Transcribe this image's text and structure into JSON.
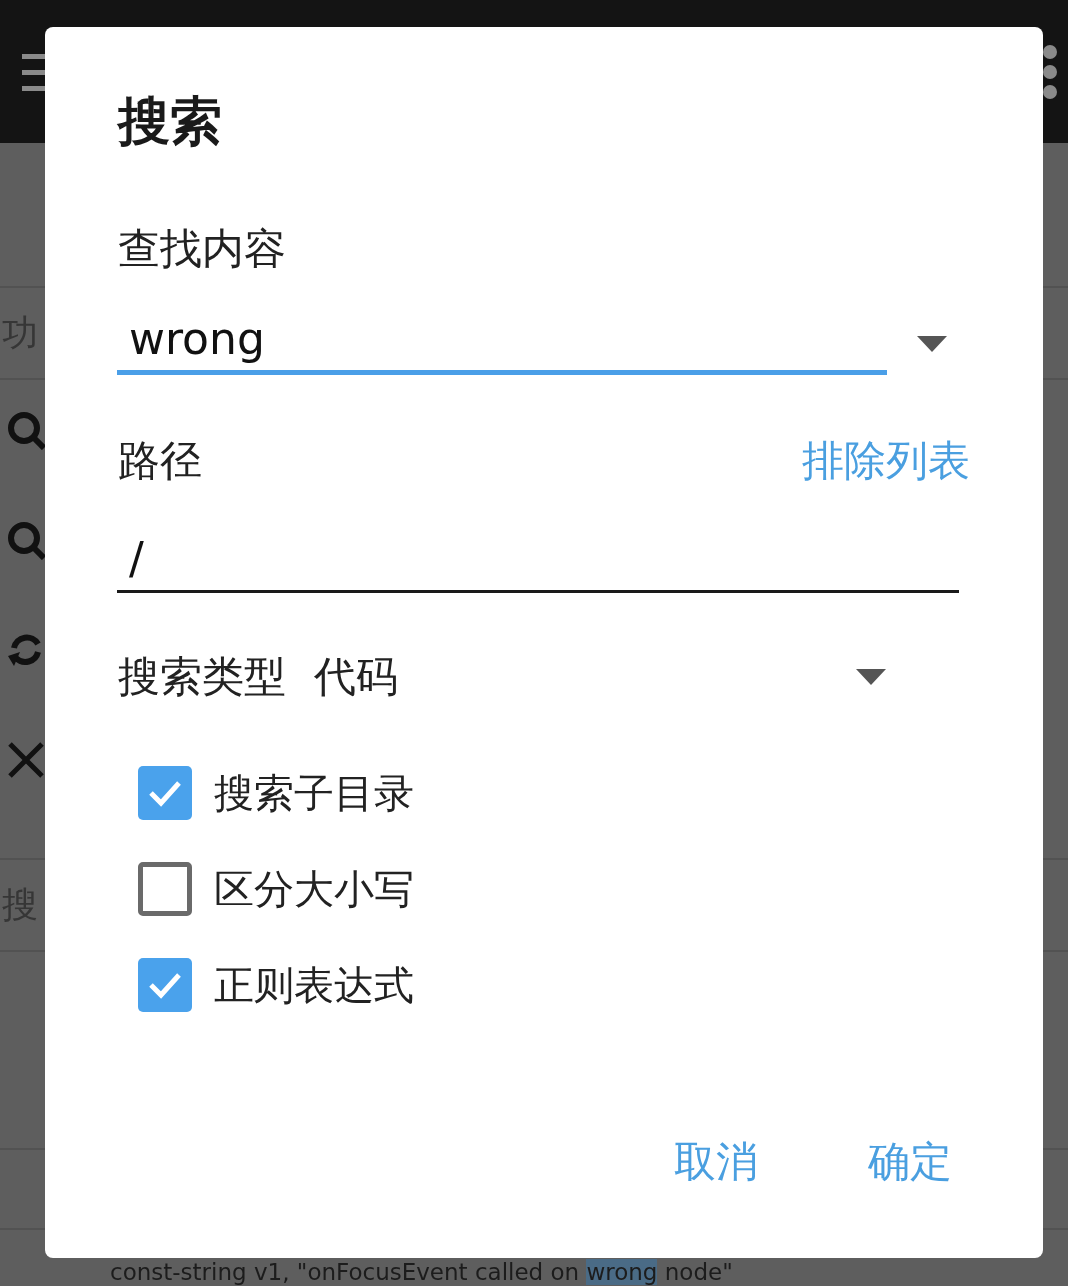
{
  "background": {
    "side_labels": [
      "功",
      "搜"
    ],
    "code_line": {
      "before": "const-string v1, \"onFocusEvent called on ",
      "match": "wrong",
      "after": " node\""
    }
  },
  "dialog": {
    "title": "搜索",
    "find": {
      "label": "查找内容",
      "value": "wrong"
    },
    "path": {
      "label": "路径",
      "link": "排除列表",
      "value": "/"
    },
    "search_type": {
      "label": "搜索类型",
      "value": "代码"
    },
    "options": [
      {
        "label": "搜索子目录",
        "checked": true
      },
      {
        "label": "区分大小写",
        "checked": false
      },
      {
        "label": "正则表达式",
        "checked": true
      }
    ],
    "buttons": [
      "取消",
      "确定"
    ]
  }
}
